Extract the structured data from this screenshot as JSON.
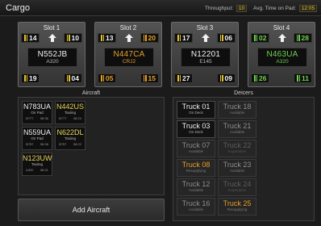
{
  "header": {
    "title": "Cargo",
    "throughput_label": "Throughput:",
    "throughput_value": "10",
    "avg_label": "Avg. Time on Pad:",
    "avg_value": "12:05"
  },
  "slots": [
    {
      "title": "Slot 1",
      "tl": "14",
      "tr": "10",
      "bl": "19",
      "br": "04",
      "plane": "N552JB",
      "type": "A320"
    },
    {
      "title": "Slot 2",
      "tl": "13",
      "tr": "20",
      "bl": "05",
      "br": "15",
      "plane": "N447CA",
      "type": "CRJ2"
    },
    {
      "title": "Slot 3",
      "tl": "17",
      "tr": "06",
      "bl": "27",
      "br": "09",
      "plane": "N12201",
      "type": "E145"
    },
    {
      "title": "Slot 4",
      "tl": "02",
      "tr": "28",
      "bl": "26",
      "br": "11",
      "plane": "N463UA",
      "type": "A320"
    }
  ],
  "aircraft_section": {
    "label": "Aircraft",
    "items": [
      {
        "id": "N783UA",
        "status": "On Pad",
        "type": "B777",
        "time": "08:36"
      },
      {
        "id": "N442US",
        "status": "Taxiing",
        "type": "B777",
        "time": "08:24"
      },
      {
        "id": "N559UA",
        "status": "On Pad",
        "type": "B757",
        "time": "08:38"
      },
      {
        "id": "N622DL",
        "status": "Taxiing",
        "type": "B757",
        "time": "08:22"
      },
      {
        "id": "N123UW",
        "status": "Taxiing",
        "type": "A320",
        "time": "08:31"
      }
    ],
    "add_button": "Add Aircraft"
  },
  "deicers_section": {
    "label": "Deicers",
    "trucks": [
      {
        "name": "Truck 01",
        "status": "On Deck"
      },
      {
        "name": "Truck 18",
        "status": "Available"
      },
      {
        "name": "Truck 03",
        "status": "On Deck"
      },
      {
        "name": "Truck 21",
        "status": "Available"
      },
      {
        "name": "Truck 07",
        "status": "Available"
      },
      {
        "name": "Truck 22",
        "status": "Inoperative"
      },
      {
        "name": "Truck 08",
        "status": "Resupplying"
      },
      {
        "name": "Truck 23",
        "status": "Available"
      },
      {
        "name": "Truck 12",
        "status": "Available"
      },
      {
        "name": "Truck 24",
        "status": "Inoperative"
      },
      {
        "name": "Truck 16",
        "status": "Available"
      },
      {
        "name": "Truck 25",
        "status": "Resupplying"
      }
    ]
  },
  "colors": {
    "amber": "#e6a025",
    "green": "#6fd04e",
    "yellow": "#e2c230"
  }
}
